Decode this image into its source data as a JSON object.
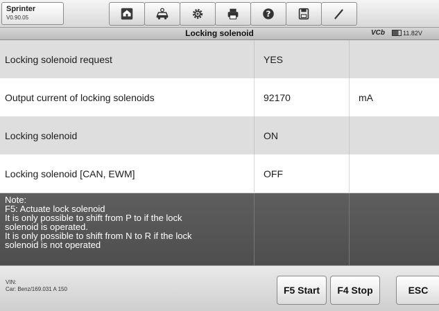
{
  "app": {
    "name": "Sprinter",
    "version": "V0.90.05"
  },
  "toolbar": {
    "icons": [
      "home-icon",
      "vehicle-icon",
      "gear-icon",
      "printer-icon",
      "help-icon",
      "save-icon",
      "pen-icon"
    ]
  },
  "header": {
    "title": "Locking solenoid",
    "vci": "VCb",
    "battery": "11.82V"
  },
  "rows": [
    {
      "name": "Locking solenoid request",
      "value": "YES",
      "unit": ""
    },
    {
      "name": "Output current of locking solenoids",
      "value": "92170",
      "unit": "mA"
    },
    {
      "name": "Locking solenoid",
      "value": "ON",
      "unit": ""
    },
    {
      "name": "Locking solenoid [CAN, EWM]",
      "value": "OFF",
      "unit": ""
    }
  ],
  "note": {
    "lines": [
      "Note:",
      "F5: Actuate lock solenoid",
      "It is only possible to shift from P to if the lock",
      "solenoid is operated.",
      "It is only possible to shift from N to R if the lock",
      "solenoid is not operated"
    ]
  },
  "footer": {
    "vin_label": "VIN:",
    "car_label": "Car: Benz/169.031 A 150",
    "buttons": {
      "start": "F5 Start",
      "stop": "F4 Stop",
      "esc": "ESC"
    }
  },
  "colors": {
    "row_shade": "#dedede",
    "note_bg": "#555555",
    "toolbar_bg": "#e0e0e0"
  }
}
